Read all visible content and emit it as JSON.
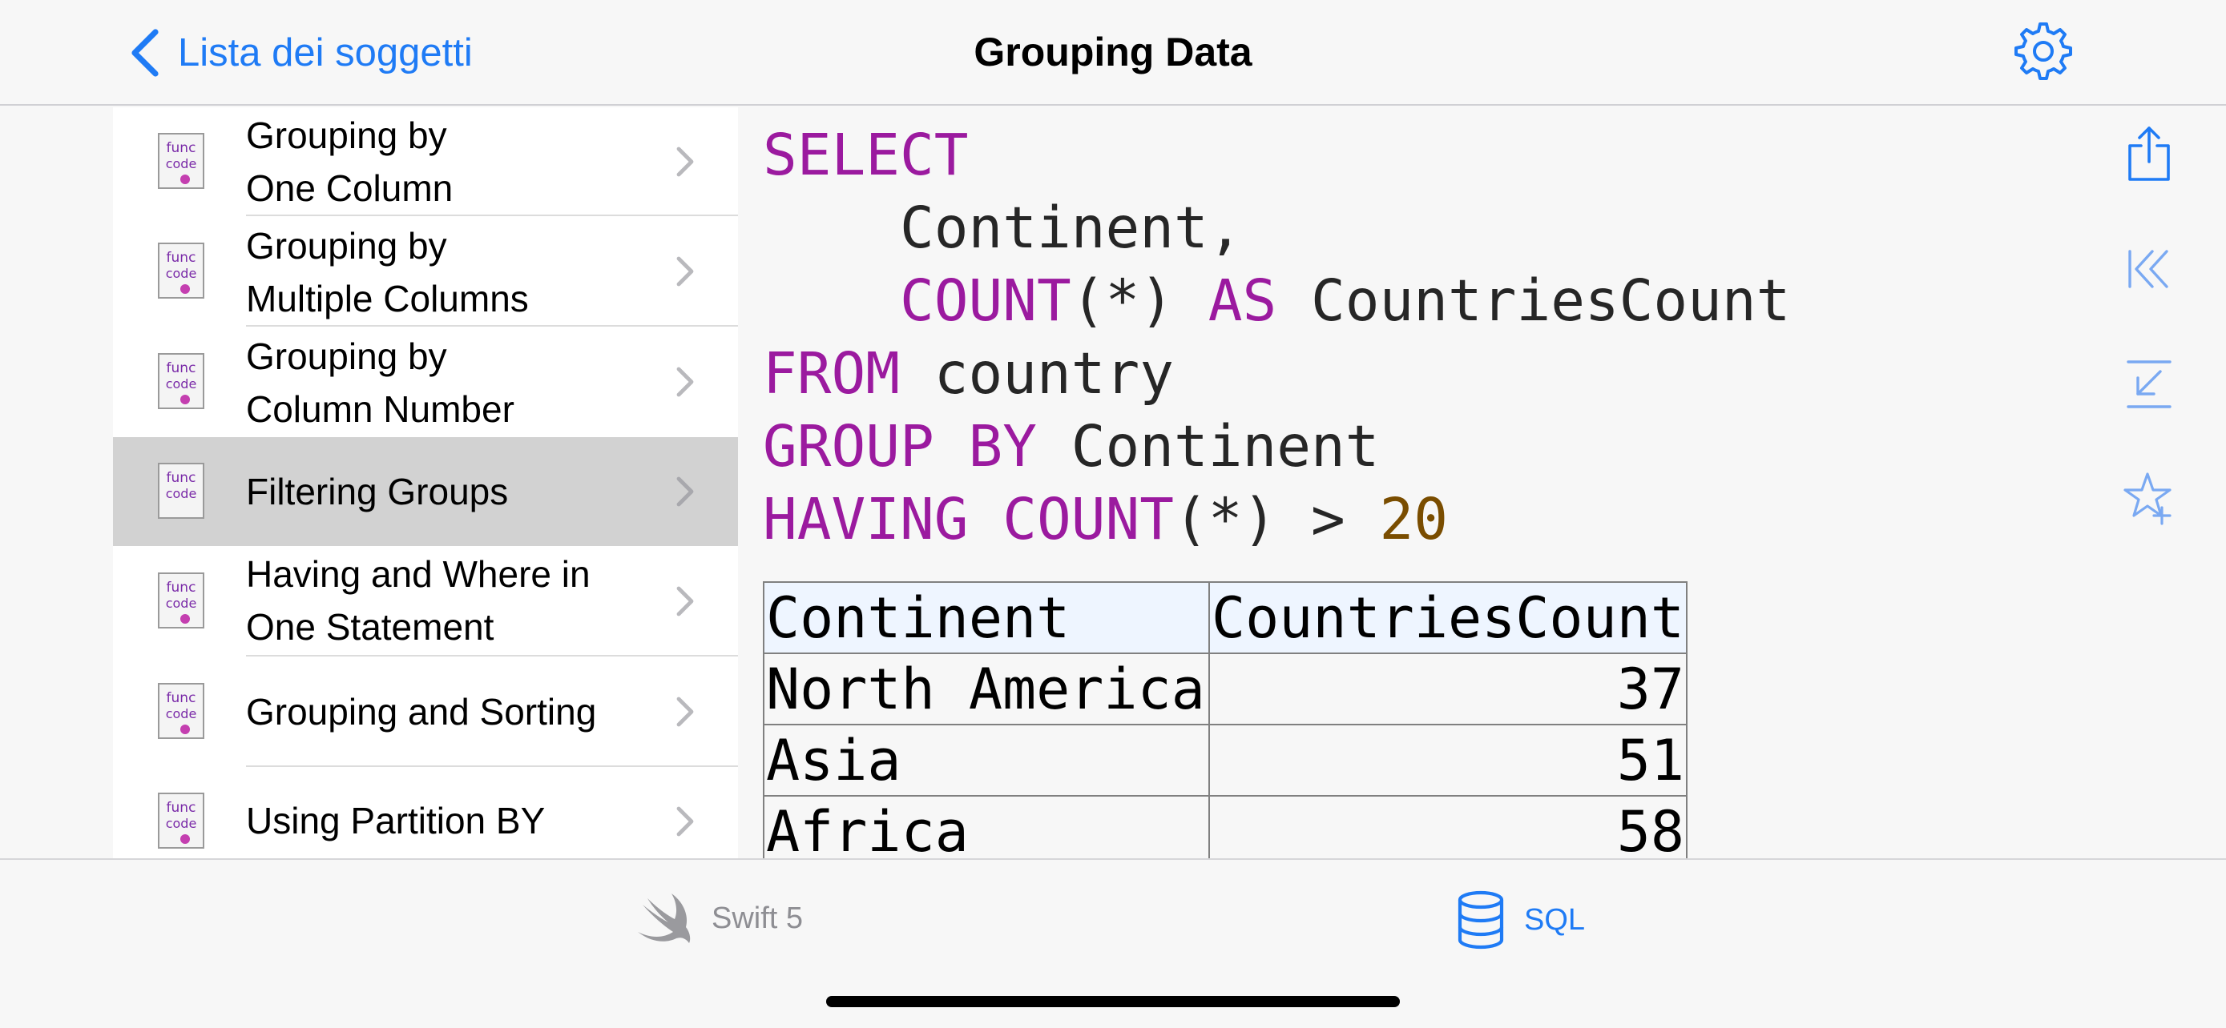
{
  "nav": {
    "back_label": "Lista dei soggetti",
    "title": "Grouping Data",
    "settings_icon": "gear-icon",
    "accent": "#1f7bf5"
  },
  "sidebar": {
    "items": [
      {
        "line1": "Grouping by",
        "line2": "One Column",
        "selected": false
      },
      {
        "line1": "Grouping by",
        "line2": "Multiple Columns",
        "selected": false
      },
      {
        "line1": "Grouping by",
        "line2": "Column Number",
        "selected": false
      },
      {
        "line1": "Filtering Groups",
        "line2": "",
        "selected": true
      },
      {
        "line1": "Having and Where in",
        "line2": "One Statement",
        "selected": false
      },
      {
        "line1": "Grouping and Sorting",
        "line2": "",
        "selected": false
      },
      {
        "line1": "Using Partition BY",
        "line2": "",
        "selected": false
      }
    ],
    "icon_text": {
      "func": "func",
      "code": "code"
    }
  },
  "code": {
    "kw_select": "SELECT",
    "col1": "Continent,",
    "kw_count": "COUNT",
    "star": "(*)",
    "kw_as": "AS",
    "alias": "CountriesCount",
    "kw_from": "FROM",
    "table": "country",
    "kw_group_by": "GROUP BY",
    "group_col": "Continent",
    "kw_having": "HAVING",
    "kw_count2": "COUNT",
    "star2": "(*)",
    "op": ">",
    "threshold": "20",
    "keyword_color": "#9b1a9f",
    "number_color": "#7a4d00"
  },
  "result": {
    "headers": [
      "Continent",
      "CountriesCount"
    ],
    "rows": [
      [
        "North America",
        "37"
      ],
      [
        "Asia",
        "51"
      ],
      [
        "Africa",
        "58"
      ]
    ]
  },
  "toolbar": {
    "icons": [
      "share-icon",
      "jump-to-start-icon",
      "collapse-icon",
      "add-favorite-icon"
    ]
  },
  "tabbar": {
    "swift_label": "Swift 5",
    "sql_label": "SQL",
    "active_tab": "SQL"
  }
}
